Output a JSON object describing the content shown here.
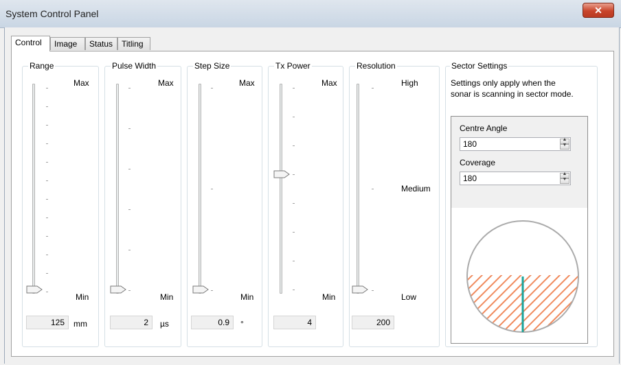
{
  "window": {
    "title": "System Control Panel"
  },
  "tabs": [
    {
      "label": "Control",
      "active": true
    },
    {
      "label": "Image",
      "active": false
    },
    {
      "label": "Status",
      "active": false
    },
    {
      "label": "Titling",
      "active": false
    }
  ],
  "sliders": [
    {
      "legend": "Range",
      "top_label": "Max",
      "bottom_label": "Min",
      "value": "125",
      "unit": "mm",
      "thumb_level": 0
    },
    {
      "legend": "Pulse Width",
      "top_label": "Max",
      "bottom_label": "Min",
      "value": "2",
      "unit": "µs",
      "thumb_level": 0
    },
    {
      "legend": "Step Size",
      "top_label": "Max",
      "bottom_label": "Min",
      "value": "0.9",
      "unit": "°",
      "thumb_level": 0
    },
    {
      "legend": "Tx Power",
      "top_label": "Max",
      "bottom_label": "Min",
      "value": "4",
      "unit": "",
      "thumb_level": 0.5
    },
    {
      "legend": "Resolution",
      "top_label": "High",
      "mid_label": "Medium",
      "bottom_label": "Low",
      "value": "200",
      "unit": "",
      "thumb_level": 0
    }
  ],
  "sector": {
    "legend": "Sector Settings",
    "note_line1": "Settings only apply when the",
    "note_line2": "sonar is scanning in sector mode.",
    "centre_angle_label": "Centre Angle",
    "centre_angle_value": "180",
    "coverage_label": "Coverage",
    "coverage_value": "180",
    "colors": {
      "hatch": "#f08a5d",
      "center_line": "#1aa39a",
      "circle": "#aaaaaa"
    }
  },
  "icons": {
    "close": "close-icon",
    "spin_up": "spin-up-icon",
    "spin_down": "spin-down-icon"
  }
}
